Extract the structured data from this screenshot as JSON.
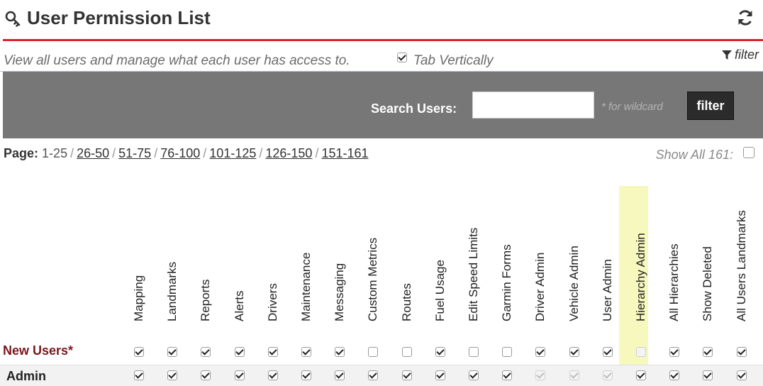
{
  "header": {
    "title": "User Permission List",
    "title_icon": "key-icon",
    "refresh_icon": "refresh-icon"
  },
  "description": {
    "text": "View all users and manage what each user has access to.",
    "tab_vertically_label": "Tab Vertically",
    "tab_vertically_checked": true,
    "filter_link": "filter"
  },
  "search": {
    "label": "Search Users:",
    "value": "",
    "placeholder": "",
    "wildcard_hint": "* for wildcard",
    "button_label": "filter"
  },
  "pager": {
    "label": "Page:",
    "current": "1-25",
    "links": [
      "26-50",
      "51-75",
      "76-100",
      "101-125",
      "126-150",
      "151-161"
    ],
    "show_all_label": "Show All 161:",
    "show_all_checked": false
  },
  "columns": [
    "Mapping",
    "Landmarks",
    "Reports",
    "Alerts",
    "Drivers",
    "Maintenance",
    "Messaging",
    "Custom Metrics",
    "Routes",
    "Fuel Usage",
    "Edit Speed Limits",
    "Garmin Forms",
    "Driver Admin",
    "Vehicle Admin",
    "User Admin",
    "Hierarchy Admin",
    "All Hierarchies",
    "Show Deleted",
    "All Users Landmarks"
  ],
  "highlighted_column": "Hierarchy Admin",
  "rows": [
    {
      "name": "New Users*",
      "checked": [
        true,
        true,
        true,
        true,
        true,
        true,
        true,
        false,
        false,
        true,
        false,
        false,
        true,
        true,
        true,
        false,
        true,
        true,
        true
      ],
      "disabled": [
        false,
        false,
        false,
        false,
        false,
        false,
        false,
        false,
        false,
        false,
        false,
        false,
        false,
        false,
        false,
        true,
        false,
        false,
        false
      ]
    },
    {
      "name": "Admin",
      "checked": [
        true,
        true,
        true,
        true,
        true,
        true,
        true,
        true,
        true,
        true,
        true,
        true,
        true,
        true,
        true,
        true,
        true,
        true,
        true
      ],
      "disabled": [
        false,
        false,
        false,
        false,
        false,
        false,
        false,
        false,
        false,
        false,
        false,
        false,
        true,
        true,
        true,
        false,
        false,
        false,
        false
      ]
    }
  ],
  "colors": {
    "accent_rule": "#d9242b",
    "search_band": "#777777",
    "highlight": "#f6f8be",
    "new_users_label": "#7a1720"
  }
}
